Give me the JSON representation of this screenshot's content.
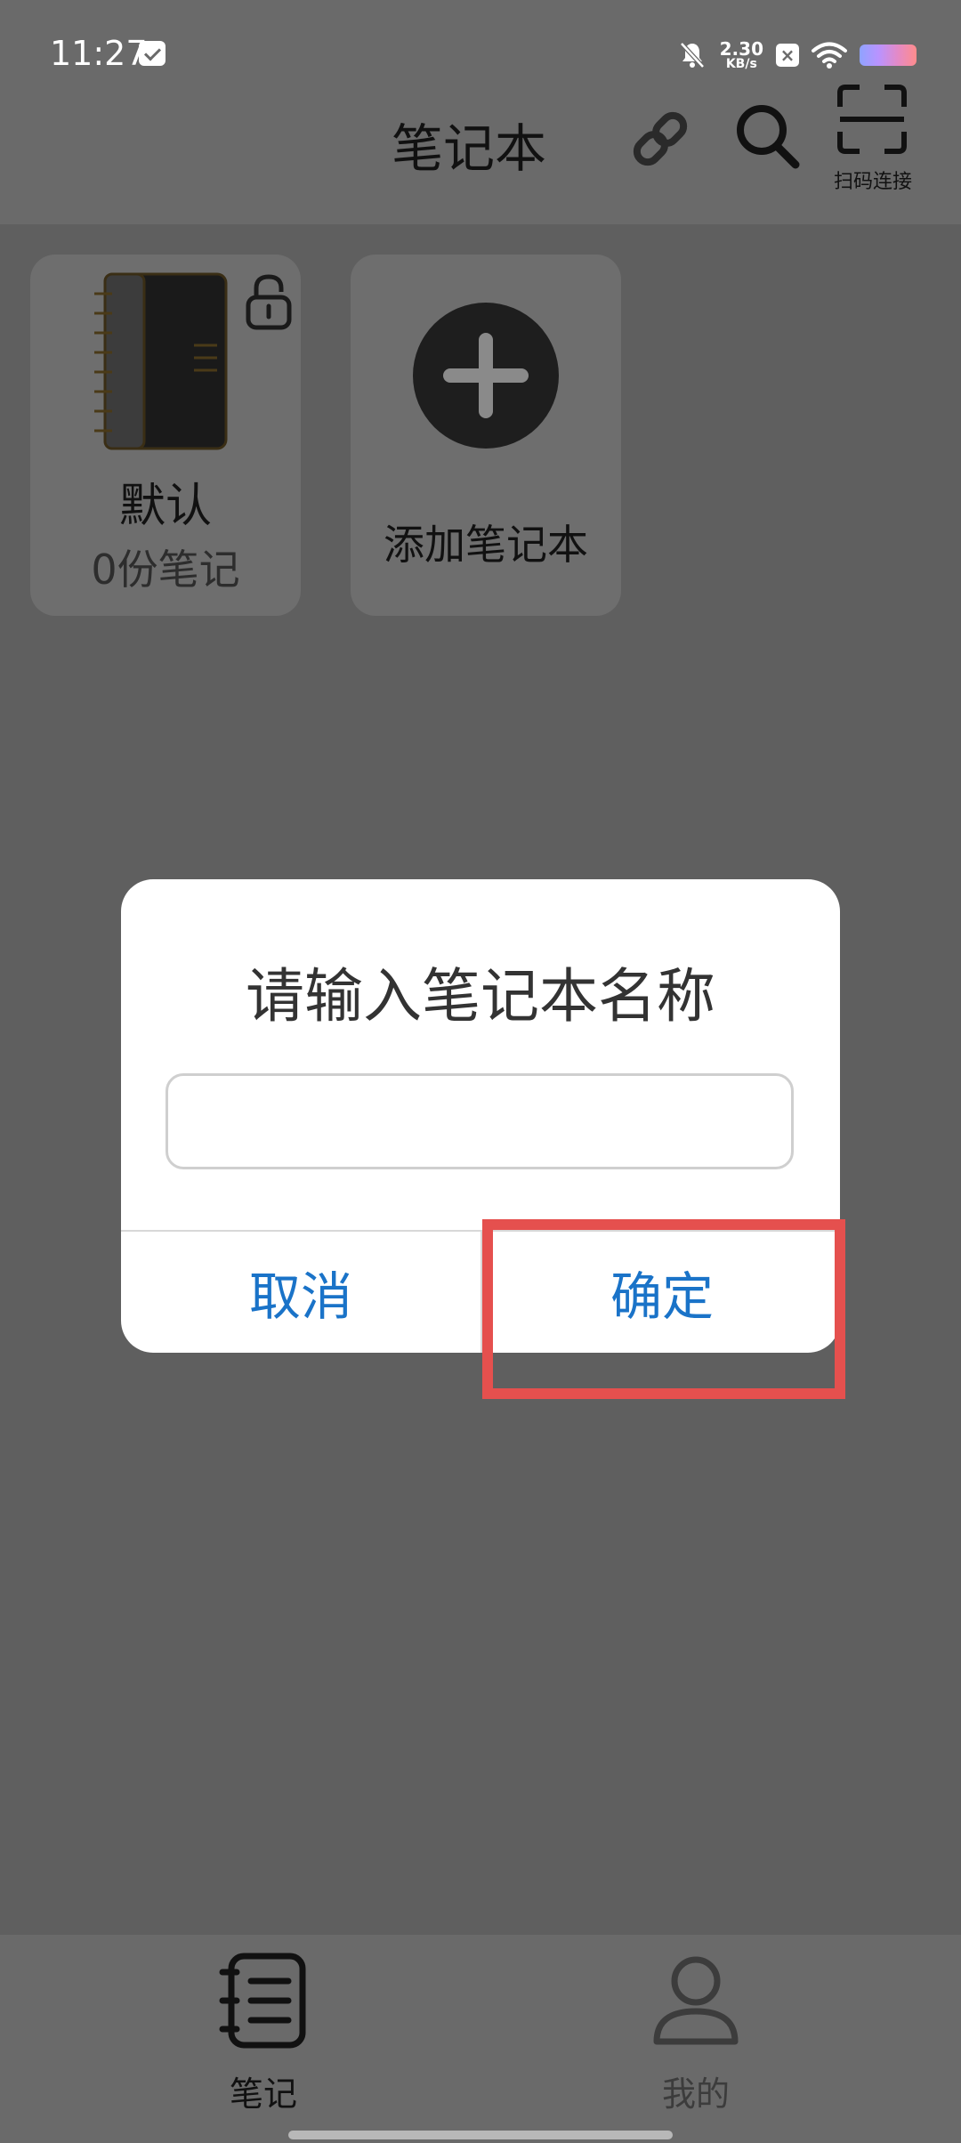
{
  "status_bar": {
    "time": "11:27",
    "net_speed_value": "2.30",
    "net_speed_unit": "KB/s",
    "x_badge": "×"
  },
  "header": {
    "title": "笔记本",
    "scan_label": "扫码连接",
    "icons": [
      "link-icon",
      "search-icon",
      "scan-icon"
    ]
  },
  "notebooks": [
    {
      "name": "默认",
      "count_label": "0份笔记",
      "locked": true
    }
  ],
  "add_card": {
    "label": "添加笔记本",
    "icon": "plus-icon"
  },
  "dialog": {
    "title": "请输入笔记本名称",
    "input_value": "",
    "cancel_label": "取消",
    "confirm_label": "确定",
    "button_color": "#1a73c8"
  },
  "highlight_color": "#e5504e",
  "bottom_nav": {
    "items": [
      {
        "label": "笔记",
        "icon": "notes-icon",
        "active": true
      },
      {
        "label": "我的",
        "icon": "person-icon",
        "active": false
      }
    ]
  }
}
